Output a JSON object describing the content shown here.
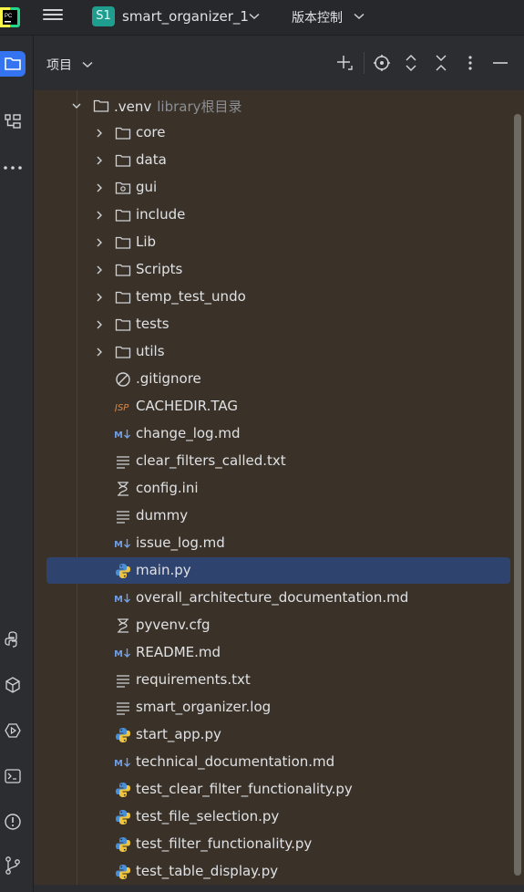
{
  "titlebar": {
    "project_badge": "S1",
    "project_name": "smart_organizer_1",
    "vcs_label": "版本控制"
  },
  "panel": {
    "title": "项目"
  },
  "tree": {
    "root": {
      "name": ".venv",
      "hint": "library根目录"
    },
    "folders": [
      {
        "name": "core",
        "icon": "folder-icon"
      },
      {
        "name": "data",
        "icon": "folder-icon"
      },
      {
        "name": "gui",
        "icon": "package-folder-icon"
      },
      {
        "name": "include",
        "icon": "folder-icon"
      },
      {
        "name": "Lib",
        "icon": "folder-icon"
      },
      {
        "name": "Scripts",
        "icon": "folder-icon"
      },
      {
        "name": "temp_test_undo",
        "icon": "folder-icon"
      },
      {
        "name": "tests",
        "icon": "folder-icon"
      },
      {
        "name": "utils",
        "icon": "folder-icon"
      }
    ],
    "files": [
      {
        "name": ".gitignore",
        "icon": "ignore-file-icon"
      },
      {
        "name": "CACHEDIR.TAG",
        "icon": "jsp-file-icon"
      },
      {
        "name": "change_log.md",
        "icon": "markdown-file-icon"
      },
      {
        "name": "clear_filters_called.txt",
        "icon": "text-file-icon"
      },
      {
        "name": "config.ini",
        "icon": "config-file-icon"
      },
      {
        "name": "dummy",
        "icon": "text-file-icon"
      },
      {
        "name": "issue_log.md",
        "icon": "markdown-file-icon"
      },
      {
        "name": "main.py",
        "icon": "python-file-icon",
        "selected": true
      },
      {
        "name": "overall_architecture_documentation.md",
        "icon": "markdown-file-icon"
      },
      {
        "name": "pyvenv.cfg",
        "icon": "config-file-icon"
      },
      {
        "name": "README.md",
        "icon": "markdown-file-icon"
      },
      {
        "name": "requirements.txt",
        "icon": "text-file-icon"
      },
      {
        "name": "smart_organizer.log",
        "icon": "text-file-icon"
      },
      {
        "name": "start_app.py",
        "icon": "python-file-icon"
      },
      {
        "name": "technical_documentation.md",
        "icon": "markdown-file-icon"
      },
      {
        "name": "test_clear_filter_functionality.py",
        "icon": "python-file-icon"
      },
      {
        "name": "test_file_selection.py",
        "icon": "python-file-icon"
      },
      {
        "name": "test_filter_functionality.py",
        "icon": "python-file-icon"
      },
      {
        "name": "test_table_display.py",
        "icon": "python-file-icon"
      }
    ]
  },
  "colors": {
    "tree_bg": "#3a3228",
    "selection": "#2e436e",
    "accent": "#3574f0",
    "markdown": "#6f9fe8",
    "python_blue": "#4a8fd6",
    "python_yellow": "#f0c43c",
    "jsp": "#d98a4e"
  }
}
